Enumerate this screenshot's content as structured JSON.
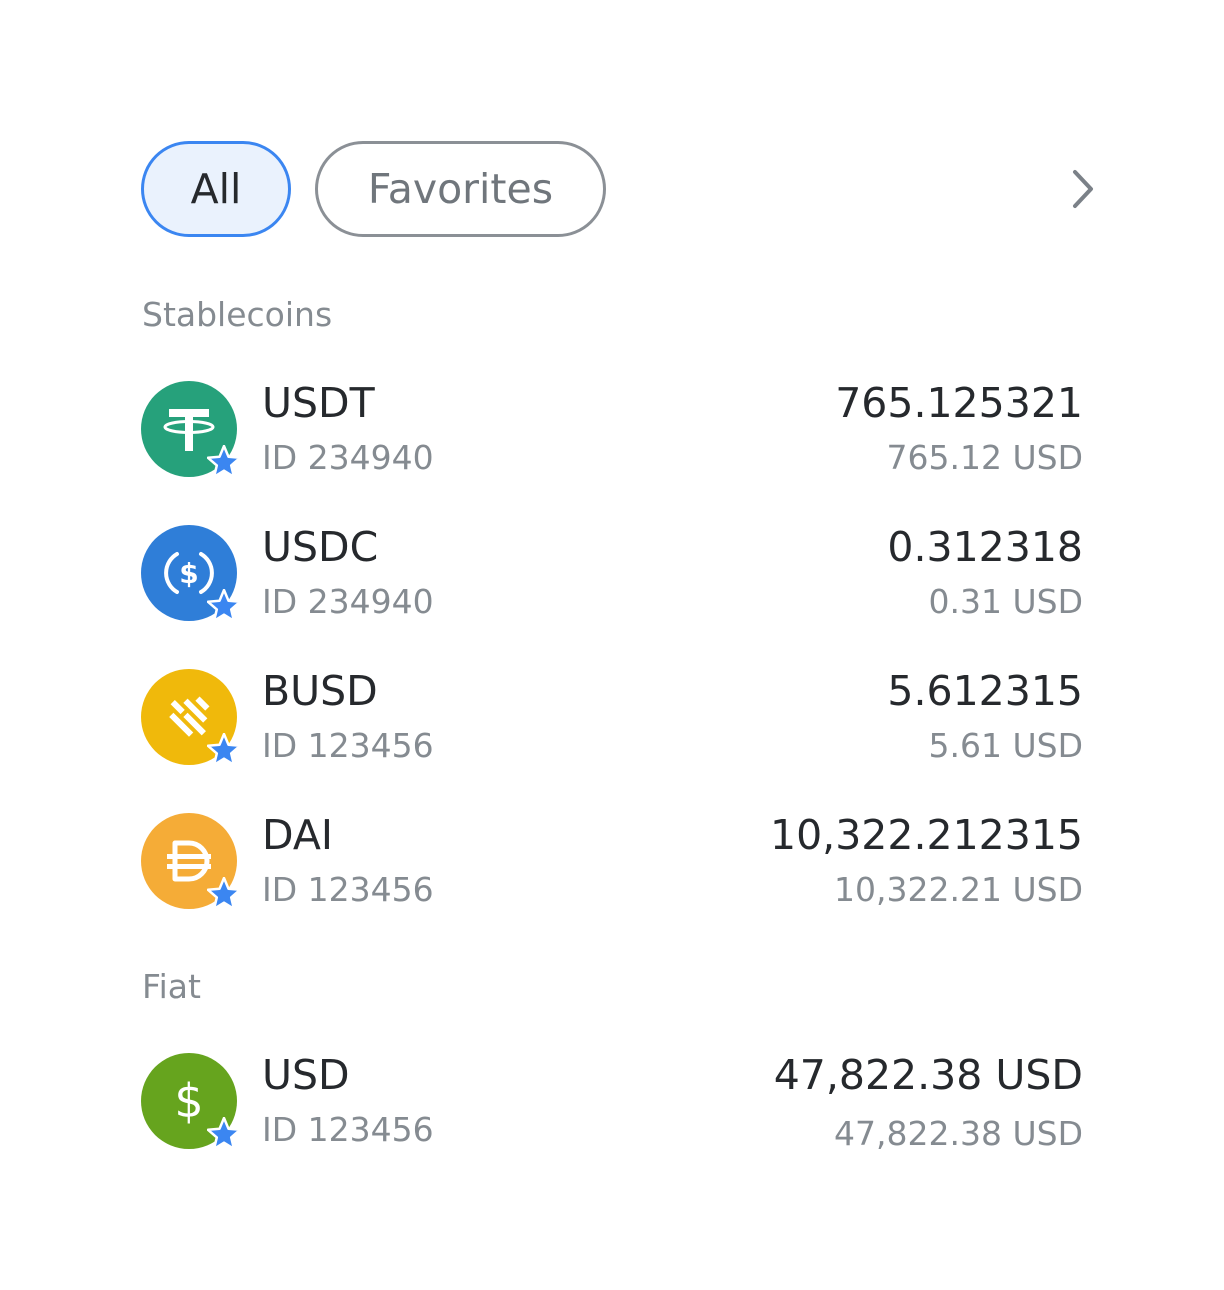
{
  "filters": {
    "all_label": "All",
    "favorites_label": "Favorites"
  },
  "sections": [
    {
      "title": "Stablecoins",
      "items": [
        {
          "symbol": "USDT",
          "id": "ID 234940",
          "amount": "765.125321",
          "fiat": "765.12 USD",
          "icon": "tether-icon",
          "color": "#26a17b"
        },
        {
          "symbol": "USDC",
          "id": "ID 234940",
          "amount": "0.312318",
          "fiat": "0.31 USD",
          "icon": "usdc-icon",
          "color": "#2f7ed8"
        },
        {
          "symbol": "BUSD",
          "id": "ID 123456",
          "amount": "5.612315",
          "fiat": "5.61 USD",
          "icon": "busd-icon",
          "color": "#f0b90b"
        },
        {
          "symbol": "DAI",
          "id": "ID 123456",
          "amount": "10,322.212315",
          "fiat": "10,322.21 USD",
          "icon": "dai-icon",
          "color": "#f5ac37"
        }
      ]
    },
    {
      "title": "Fiat",
      "items": [
        {
          "symbol": "USD",
          "id": "ID 123456",
          "amount": "47,822.38 USD",
          "fiat": "47,822.38 USD",
          "icon": "dollar-icon",
          "color": "#66a41e"
        }
      ]
    }
  ],
  "colors": {
    "accent": "#3b86f1",
    "favorite_star": "#3b86f1"
  }
}
